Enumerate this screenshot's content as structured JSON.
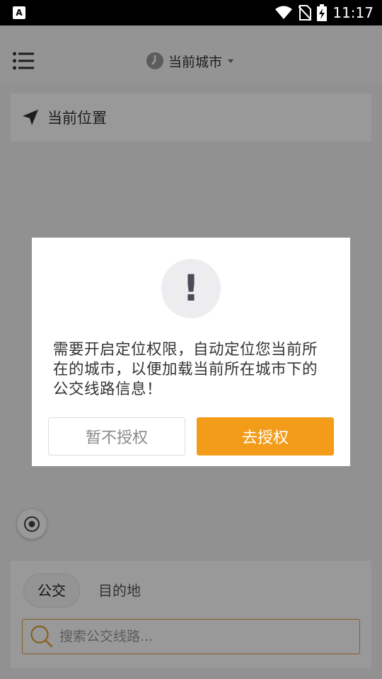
{
  "status_bar": {
    "time": "11:17",
    "notification_glyph": "A",
    "icons": [
      "wifi-icon",
      "no-sim-icon",
      "battery-charging-icon"
    ]
  },
  "header": {
    "menu_icon": "list-menu-icon",
    "city_label": "当前城市"
  },
  "location_card": {
    "label": "当前位置"
  },
  "dialog": {
    "alert_glyph": "!",
    "message": "需要开启定位权限，自动定位您当前所在的城市，以便加载当前所在城市下的公交线路信息！",
    "deny_label": "暂不授权",
    "grant_label": "去授权"
  },
  "bottom": {
    "tabs": [
      "公交",
      "目的地"
    ],
    "search_placeholder": "搜索公交线路..."
  },
  "colors": {
    "accent": "#f39c1a",
    "search_border": "#e2a03a",
    "overlay": "rgba(0,0,0,0.4)"
  }
}
